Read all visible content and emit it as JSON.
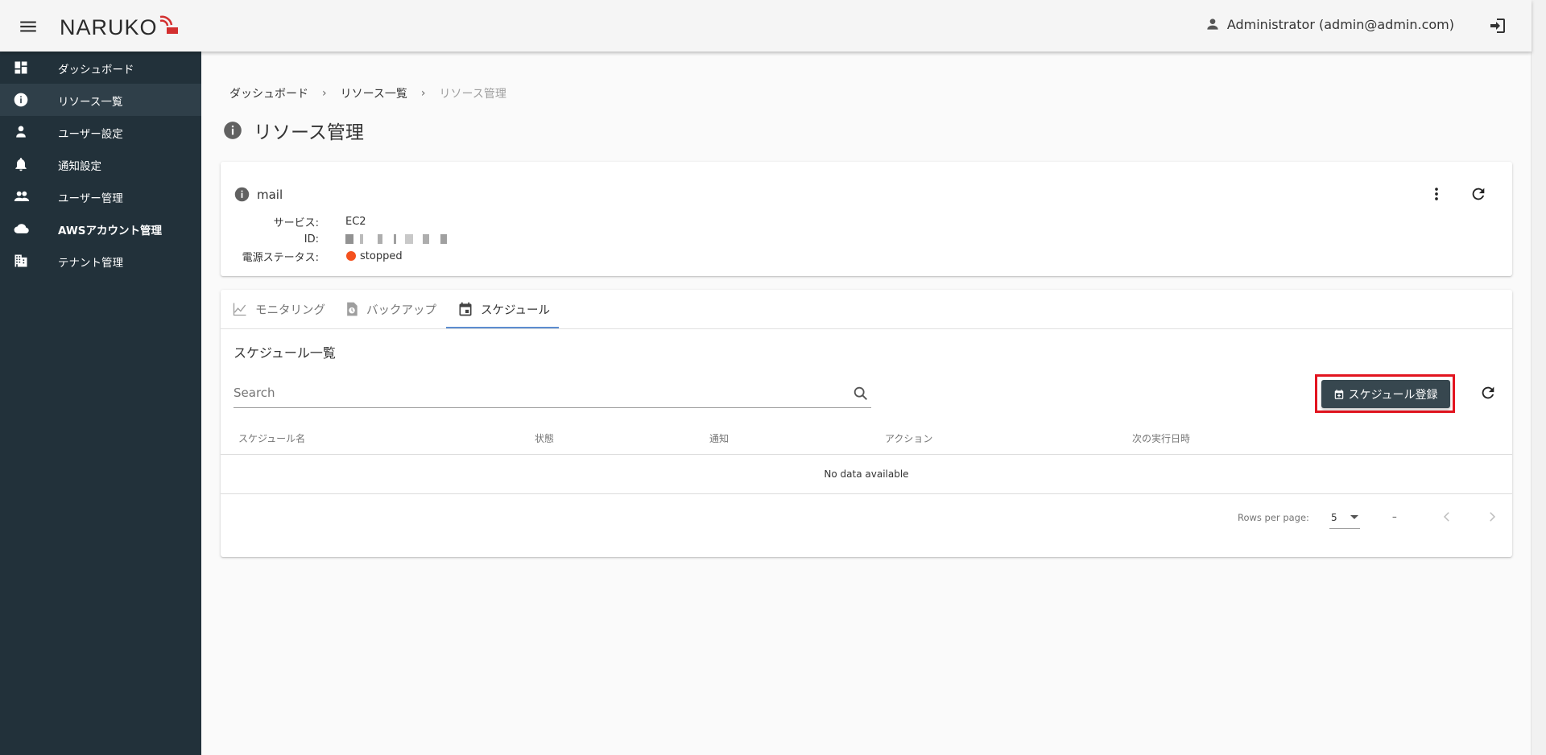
{
  "app": {
    "logo_text": "NARUKO",
    "user_label": "Administrator (admin@admin.com)"
  },
  "sidebar": {
    "items": [
      {
        "label": "ダッシュボード",
        "icon": "dashboard-icon"
      },
      {
        "label": "リソース一覧",
        "icon": "info-icon",
        "active": true
      },
      {
        "label": "ユーザー設定",
        "icon": "person-icon"
      },
      {
        "label": "通知設定",
        "icon": "bell-icon"
      },
      {
        "label": "ユーザー管理",
        "icon": "people-icon"
      },
      {
        "label": "AWSアカウント管理",
        "icon": "cloud-icon"
      },
      {
        "label": "テナント管理",
        "icon": "building-icon"
      }
    ]
  },
  "breadcrumb": {
    "items": [
      "ダッシュボード",
      "リソース一覧",
      "リソース管理"
    ],
    "separator": "›"
  },
  "page": {
    "title": "リソース管理"
  },
  "resource": {
    "name": "mail",
    "service_label": "サービス:",
    "service_value": "EC2",
    "id_label": "ID:",
    "power_label": "電源ステータス:",
    "power_value": "stopped",
    "power_color": "#f4511e"
  },
  "tabs": [
    {
      "label": "モニタリング",
      "icon": "chart-line-icon"
    },
    {
      "label": "バックアップ",
      "icon": "backup-icon"
    },
    {
      "label": "スケジュール",
      "icon": "calendar-icon",
      "active": true
    }
  ],
  "schedule": {
    "section_title": "スケジュール一覧",
    "search_placeholder": "Search",
    "register_button": "スケジュール登録",
    "columns": [
      "スケジュール名",
      "状態",
      "通知",
      "アクション",
      "次の実行日時"
    ],
    "empty_text": "No data available",
    "rows_per_page_label": "Rows per page:",
    "rows_per_page_value": "5",
    "page_range": "–"
  },
  "colors": {
    "sidebar_bg": "#22313a",
    "button_bg": "#37474f",
    "highlight_border": "#e2141f",
    "tab_indicator": "#5c8ccf"
  }
}
